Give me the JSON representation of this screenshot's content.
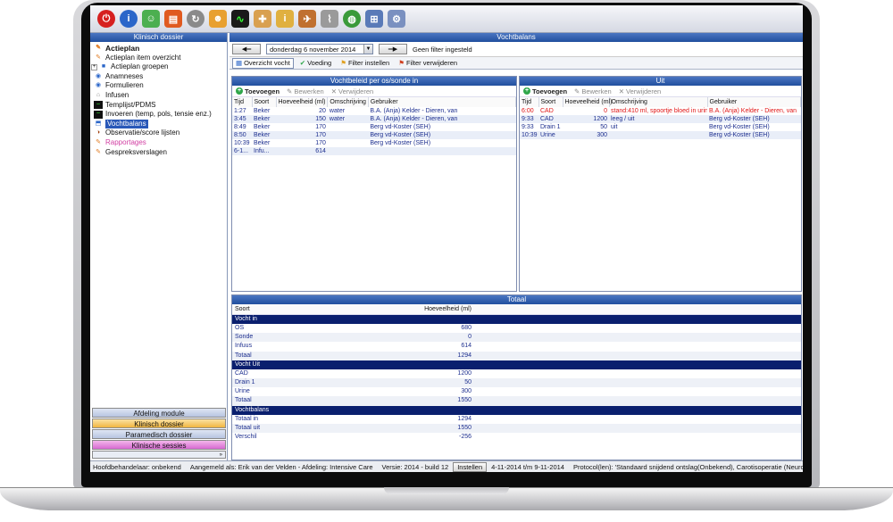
{
  "toolbar": {
    "icons": [
      "power-icon",
      "info-icon",
      "person-icon",
      "book-icon",
      "refresh-icon",
      "users-icon",
      "monitor-icon",
      "nurse-icon",
      "info-person-icon",
      "bird-icon",
      "paperclip-icon",
      "globe-icon",
      "network-icon",
      "user-settings-icon"
    ]
  },
  "sidebar": {
    "header": "Klinisch dossier",
    "items": [
      {
        "label": "Actieplan",
        "bold": true
      },
      {
        "label": "Actieplan item overzicht"
      },
      {
        "label": "Actieplan groepen",
        "expander": "+"
      },
      {
        "label": "Anamneses"
      },
      {
        "label": "Formulieren"
      },
      {
        "label": "Infusen"
      },
      {
        "label": "Templijst/PDMS"
      },
      {
        "label": "Invoeren (temp, pols, tensie enz.)"
      },
      {
        "label": "Vochtbalans",
        "selected": true
      },
      {
        "label": "Observatie/score lijsten"
      },
      {
        "label": "Rapportages",
        "pink": true
      },
      {
        "label": "Gespreksverslagen"
      }
    ],
    "nav": {
      "afdeling": "Afdeling module",
      "klinisch": "Klinisch dossier",
      "paramedisch": "Paramedisch dossier",
      "sessies": "Klinische sessies"
    }
  },
  "main": {
    "header": "Vochtbalans",
    "date": "donderdag   6 november 2014",
    "filter_status": "Geen filter ingesteld",
    "tabs": {
      "overzicht": "Overzicht vocht",
      "voeding": "Voeding",
      "filter_in": "Filter instellen",
      "filter_weg": "Filter verwijderen"
    },
    "actions": {
      "add": "Toevoegen",
      "edit": "Bewerken",
      "remove": "Verwijderen"
    },
    "in_panel": {
      "header": "Vochtbeleid per os/sonde in",
      "columns": [
        "Tijd",
        "Soort",
        "Hoeveelheid (ml)",
        "Omschrijving",
        "Gebruiker"
      ],
      "rows": [
        [
          "1:27",
          "Beker",
          "20",
          "water",
          "B.A. (Anja) Kelder - Dieren, van"
        ],
        [
          "3:45",
          "Beker",
          "150",
          "water",
          "B.A. (Anja) Kelder - Dieren, van"
        ],
        [
          "8:49",
          "Beker",
          "170",
          "",
          "Berg vd-Koster (SEH)"
        ],
        [
          "8:50",
          "Beker",
          "170",
          "",
          "Berg vd-Koster (SEH)"
        ],
        [
          "10:39",
          "Beker",
          "170",
          "",
          "Berg vd-Koster (SEH)"
        ],
        [
          "6-1...",
          "Infu...",
          "614",
          "",
          ""
        ]
      ]
    },
    "out_panel": {
      "header": "Uit",
      "columns": [
        "Tijd",
        "Soort",
        "Hoeveelheid (ml)",
        "Omschrijving",
        "Gebruiker"
      ],
      "rows": [
        [
          "6:00",
          "CAD",
          "0",
          "stand:410 ml, spoortje bloed in urine!",
          "B.A. (Anja) Kelder - Dieren, van"
        ],
        [
          "9:33",
          "CAD",
          "1200",
          "leeg / uit",
          "Berg vd-Koster (SEH)"
        ],
        [
          "9:33",
          "Drain 1",
          "50",
          "uit",
          "Berg vd-Koster (SEH)"
        ],
        [
          "10:39",
          "Urine",
          "300",
          "",
          "Berg vd-Koster (SEH)"
        ]
      ]
    },
    "totaal": {
      "header": "Totaal",
      "col_soort": "Soort",
      "col_hoev": "Hoeveelheid (ml)",
      "sections": [
        {
          "title": "Vocht in",
          "rows": [
            [
              "OS",
              "680"
            ],
            [
              "Sonde",
              "0"
            ],
            [
              "Infuus",
              "614"
            ],
            [
              "Totaal",
              "1294"
            ]
          ]
        },
        {
          "title": "Vocht Uit",
          "rows": [
            [
              "CAD",
              "1200"
            ],
            [
              "Drain 1",
              "50"
            ],
            [
              "Urine",
              "300"
            ],
            [
              "Totaal",
              "1550"
            ]
          ]
        },
        {
          "title": "Vochtbalans",
          "rows": [
            [
              "Totaal in",
              "1294"
            ],
            [
              "Totaal uit",
              "1550"
            ],
            [
              "Verschil",
              "-256"
            ]
          ]
        }
      ]
    }
  },
  "status": {
    "hoofd": "Hoofdbehandelaar: onbekend",
    "aangemeld": "Aangemeld als: Erik van der Velden - Afdeling: Intensive Care",
    "versie": "Versie: 2014 - build 12",
    "instellen": "Instellen",
    "periode": "4-11-2014 t/m 9-11-2014",
    "protocol": "Protocol(len): 'Standaard snijdend ontslag(Onbekend), Carotisoperatie (Neurologie)"
  }
}
